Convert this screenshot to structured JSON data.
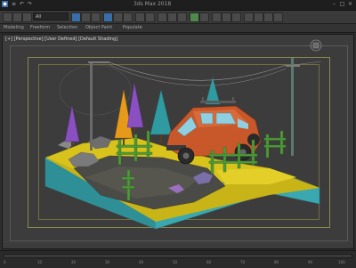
{
  "app": {
    "title": "3ds Max 2018"
  },
  "toolbar": {
    "selection_filter": "All"
  },
  "ribbon": {
    "tabs": [
      "Modeling",
      "Freeform",
      "Selection",
      "Object Paint",
      "Populate"
    ]
  },
  "viewport": {
    "label": "[+] [Perspective] [User Defined] [Default Shading]"
  },
  "timeline": {
    "ticks": [
      "0",
      "10",
      "20",
      "30",
      "40",
      "50",
      "60",
      "70",
      "80",
      "90",
      "100"
    ]
  },
  "colors": {
    "ground_top": "#d8c21c",
    "ground_side": "#3aa8b0",
    "road": "#4a4a46",
    "car": "#c8582a",
    "tree_orange": "#e59a1a",
    "tree_purple": "#8a4fc0",
    "tree_teal": "#2f9aa0",
    "fence": "#4f9a3a"
  }
}
